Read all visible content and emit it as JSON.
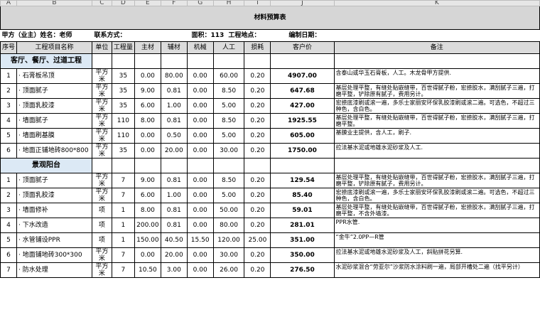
{
  "column_letters": [
    "A",
    "B",
    "C",
    "D",
    "E",
    "F",
    "G",
    "H",
    "I",
    "J",
    "K"
  ],
  "title": "材料预算表",
  "info": {
    "owner": "甲方（业主）姓名：老师",
    "contact": "联系方式：",
    "area": "面积：113",
    "location": "工程地点：",
    "date": "编制日期："
  },
  "headers": [
    "序号",
    "工程项目名称",
    "单位",
    "工程量",
    "主材",
    "辅材",
    "机械",
    "人工",
    "损耗",
    "客户价",
    "备注"
  ],
  "sections": [
    {
      "title": "客厅、餐厅、过道工程",
      "rows": [
        {
          "no": "1",
          "name": "· 石膏板吊顶",
          "unit": "平方米",
          "qty": "35",
          "main": "0.00",
          "aux": "80.00",
          "mach": "0.00",
          "labor": "60.00",
          "loss": "0.20",
          "price": "4907.00",
          "note": "含泰山或华玉石膏板，人工。木龙骨甲方提供."
        },
        {
          "no": "2",
          "name": "· 顶面腻子",
          "unit": "平方米",
          "qty": "35",
          "main": "9.00",
          "aux": "0.81",
          "mach": "0.00",
          "labor": "8.50",
          "loss": "0.20",
          "price": "647.68",
          "note": "基层处理平整，有缝处贴嵌缝带，百世得腻子粉，宏捺胶水，满刮腻子三遍，打磨平整，铲除原有腻子，费用另计。"
        },
        {
          "no": "3",
          "name": "· 顶面乳胶漆",
          "unit": "平方米",
          "qty": "35",
          "main": "6.00",
          "aux": "1.00",
          "mach": "0.00",
          "labor": "5.00",
          "loss": "0.20",
          "price": "427.00",
          "note": "宏捺底漆刷或滚一遍，多乐士家丽安环保乳胶漆刷或滚二遍。可选色，不超过三种色，含白色。"
        },
        {
          "no": "4",
          "name": "· 墙面腻子",
          "unit": "平方米",
          "qty": "110",
          "main": "8.00",
          "aux": "0.81",
          "mach": "0.00",
          "labor": "8.50",
          "loss": "0.20",
          "price": "1925.55",
          "note": "基层处理平整，有缝处贴嵌缝带，百世得腻子粉，宏捺胶水，满刮腻子三遍，打磨平整。"
        },
        {
          "no": "5",
          "name": "· 墙面刷基膜",
          "unit": "平方米",
          "qty": "110",
          "main": "0.00",
          "aux": "0.50",
          "mach": "0.00",
          "labor": "5.00",
          "loss": "0.20",
          "price": "605.00",
          "note": "基膜业主提供，含人工，刷子."
        },
        {
          "no": "6",
          "name": "· 地面正铺地砖800*800",
          "unit": "平方米",
          "qty": "35",
          "main": "0.00",
          "aux": "20.00",
          "mach": "0.00",
          "labor": "30.00",
          "loss": "0.20",
          "price": "1750.00",
          "note": "拉法基水泥或地雄水泥砂浆及人工."
        }
      ]
    },
    {
      "title": "景观阳台",
      "rows": [
        {
          "no": "1",
          "name": "· 顶面腻子",
          "unit": "平方米",
          "qty": "7",
          "main": "9.00",
          "aux": "0.81",
          "mach": "0.00",
          "labor": "8.50",
          "loss": "0.20",
          "price": "129.54",
          "note": "基层处理平整，有缝处贴嵌缝带，百世得腻子粉，宏捺胶水，满刮腻子三遍，打磨平整，铲除原有腻子，费用另计。"
        },
        {
          "no": "2",
          "name": "· 顶面乳胶漆",
          "unit": "平方米",
          "qty": "7",
          "main": "6.00",
          "aux": "1.00",
          "mach": "0.00",
          "labor": "5.00",
          "loss": "0.20",
          "price": "85.40",
          "note": "宏捺底漆刷或滚一遍，多乐士家丽安环保乳胶漆刷或滚二遍。可选色，不超过三种色，含白色。"
        },
        {
          "no": "3",
          "name": "· 墙面修补",
          "unit": "项",
          "qty": "1",
          "main": "8.00",
          "aux": "0.81",
          "mach": "0.00",
          "labor": "50.00",
          "loss": "0.20",
          "price": "59.01",
          "note": "基层处理平整，有缝处贴嵌缝带，百世得腻子粉，宏捺胶水，满刮腻子三遍，打磨平整，不含外墙漆。"
        },
        {
          "no": "4",
          "name": "· 下水改造",
          "unit": "项",
          "qty": "1",
          "main": "200.00",
          "aux": "0.81",
          "mach": "0.00",
          "labor": "80.00",
          "loss": "0.20",
          "price": "281.01",
          "note": "PPR水管."
        },
        {
          "no": "5",
          "name": "· 水管铺设PPR",
          "unit": "项",
          "qty": "1",
          "main": "150.00",
          "aux": "40.50",
          "mach": "15.50",
          "labor": "120.00",
          "loss": "25.00",
          "price": "351.00",
          "note": "“金牛”2.0PP—R管"
        },
        {
          "no": "6",
          "name": "· 地面铺地砖300*300",
          "unit": "平方米",
          "qty": "7",
          "main": "0.00",
          "aux": "20.00",
          "mach": "0.00",
          "labor": "30.00",
          "loss": "0.20",
          "price": "350.00",
          "note": "拉法基水泥或地雄水泥砂浆及人工，斜贴拼花另算."
        },
        {
          "no": "7",
          "name": "· 防水处理",
          "unit": "平方米",
          "qty": "7",
          "main": "10.50",
          "aux": "3.00",
          "mach": "0.00",
          "labor": "26.00",
          "loss": "0.20",
          "price": "276.50",
          "note": "水泥砂浆混合“劳亚尔”沙浆防水涂料刷一遍，局部开槽处二遍（找平另计）"
        }
      ]
    }
  ]
}
